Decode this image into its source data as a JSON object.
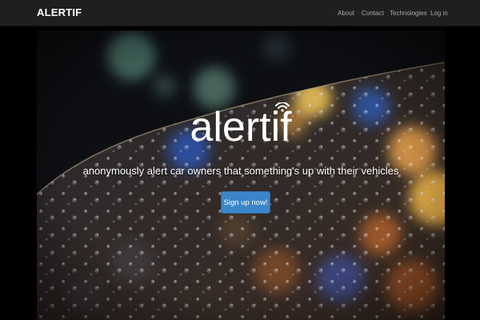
{
  "navbar": {
    "brand": "ALERTIF",
    "links": {
      "about": "About",
      "contact": "Contact",
      "technologies": "Technologies",
      "login": "Log in"
    }
  },
  "hero": {
    "logo_text": "alertif",
    "logo_icon": "wifi-signal-icon",
    "tagline": "anonymously alert car owners that something's up with their vehicles",
    "cta_label": "Sign up now!",
    "background": "rainy-windshield-bokeh-photo"
  },
  "colors": {
    "navbar_bg": "#1f1f1f",
    "nav_link": "#a9a9a9",
    "cta_bg": "#3a86c8",
    "page_bg": "#000000"
  }
}
